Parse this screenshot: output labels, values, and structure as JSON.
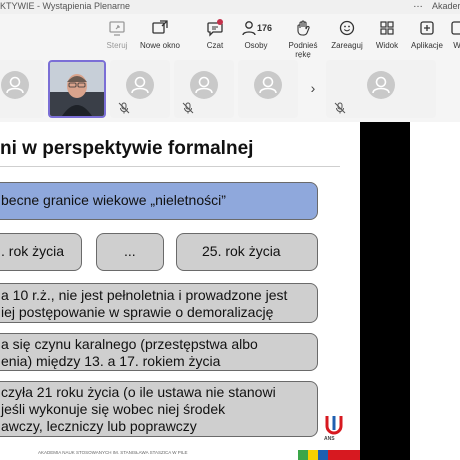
{
  "window": {
    "title": "KTYWIE - Wystąpienia Plenarne",
    "more_icon": "…",
    "org": "Akader"
  },
  "toolbar": {
    "share": {
      "label": "Steruj",
      "icon": "share-screen-icon",
      "disabled": true
    },
    "new_window": {
      "label": "Nowe okno",
      "icon": "new-window-icon"
    },
    "chat": {
      "label": "Czat",
      "icon": "chat-icon"
    },
    "people": {
      "label": "Osoby",
      "icon": "people-icon",
      "count": "176"
    },
    "raise_hand": {
      "label": "Podnieś rękę",
      "icon": "raise-hand-icon"
    },
    "react": {
      "label": "Zareaguj",
      "icon": "react-icon"
    },
    "view": {
      "label": "Widok",
      "icon": "view-icon"
    },
    "apps": {
      "label": "Aplikacje",
      "icon": "apps-icon"
    },
    "extra": {
      "label": "W",
      "icon": "more-icon"
    }
  },
  "participants": {
    "next_label": "›"
  },
  "slide": {
    "heading": "ni w perspektywie formalnej",
    "banner": "becne granice wiekowe „nieletności”",
    "age_boxes": [
      ". rok życia",
      "...",
      "25. rok życia"
    ],
    "items": [
      [
        "a 10 r.ż., nie jest pełnoletnia i prowadzone jest",
        "iej postępowanie w sprawie o demoralizację"
      ],
      [
        "a się czynu karalnego (przestępstwa albo",
        "enia) między 13. a 17. rokiem życia"
      ],
      [
        "czyła 21 roku życia (o ile ustawa nie stanowi",
        " jeśli wykonuje się wobec niej środek",
        "awczy, leczniczy lub poprawczy"
      ]
    ],
    "footer": "AKADEMIA NAUK STOSOWANYCH IM. STANISŁAWA STASZICA W PILE",
    "logo_text": "ANS"
  },
  "colors": {
    "banner": "#8fa8dc",
    "grey_box": "#cfcfcf",
    "accent_border": "#7b6fd6",
    "footer_stripes": [
      "#3aa648",
      "#f6d000",
      "#1f5fb0",
      "#d71920"
    ]
  }
}
